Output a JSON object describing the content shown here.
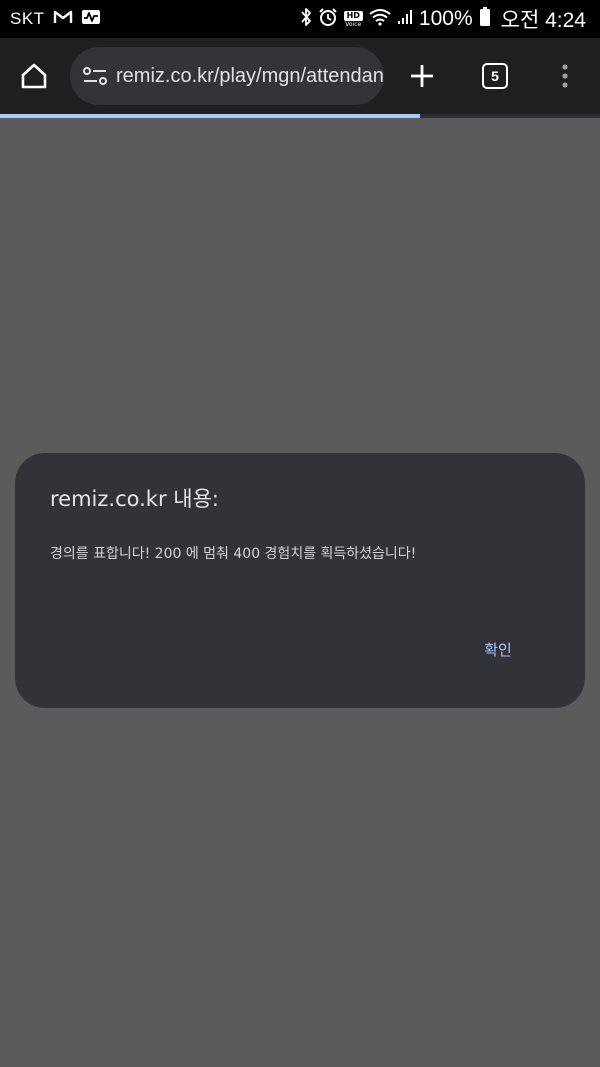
{
  "status_bar": {
    "carrier": "SKT",
    "battery_percent": "100%",
    "time": "오전 4:24",
    "hd_label": "HD",
    "voice_label": "Voice",
    "icons": [
      "gmail-icon",
      "activity-icon",
      "bluetooth-icon",
      "alarm-icon",
      "hd-voice-icon",
      "wifi-icon",
      "signal-icon",
      "battery-icon"
    ]
  },
  "toolbar": {
    "url": "remiz.co.kr/play/mgn/attendance",
    "tab_count": "5",
    "page_load_progress": 0.7,
    "icons": [
      "home-icon",
      "site-settings-icon",
      "plus-icon",
      "tab-switcher-icon",
      "more-vert-icon"
    ]
  },
  "dialog": {
    "title": "remiz.co.kr 내용:",
    "message": "경의를 표합니다! 200 에 멈춰 400 경험치를 획득하셨습니다!",
    "ok_label": "확인"
  },
  "colors": {
    "status_bar_bg": "#000000",
    "toolbar_bg": "#1f1f1f",
    "omnibox_bg": "#333338",
    "scrim_bg": "#5b5b5b",
    "dialog_bg": "#323338",
    "accent": "#a8c7fa"
  }
}
